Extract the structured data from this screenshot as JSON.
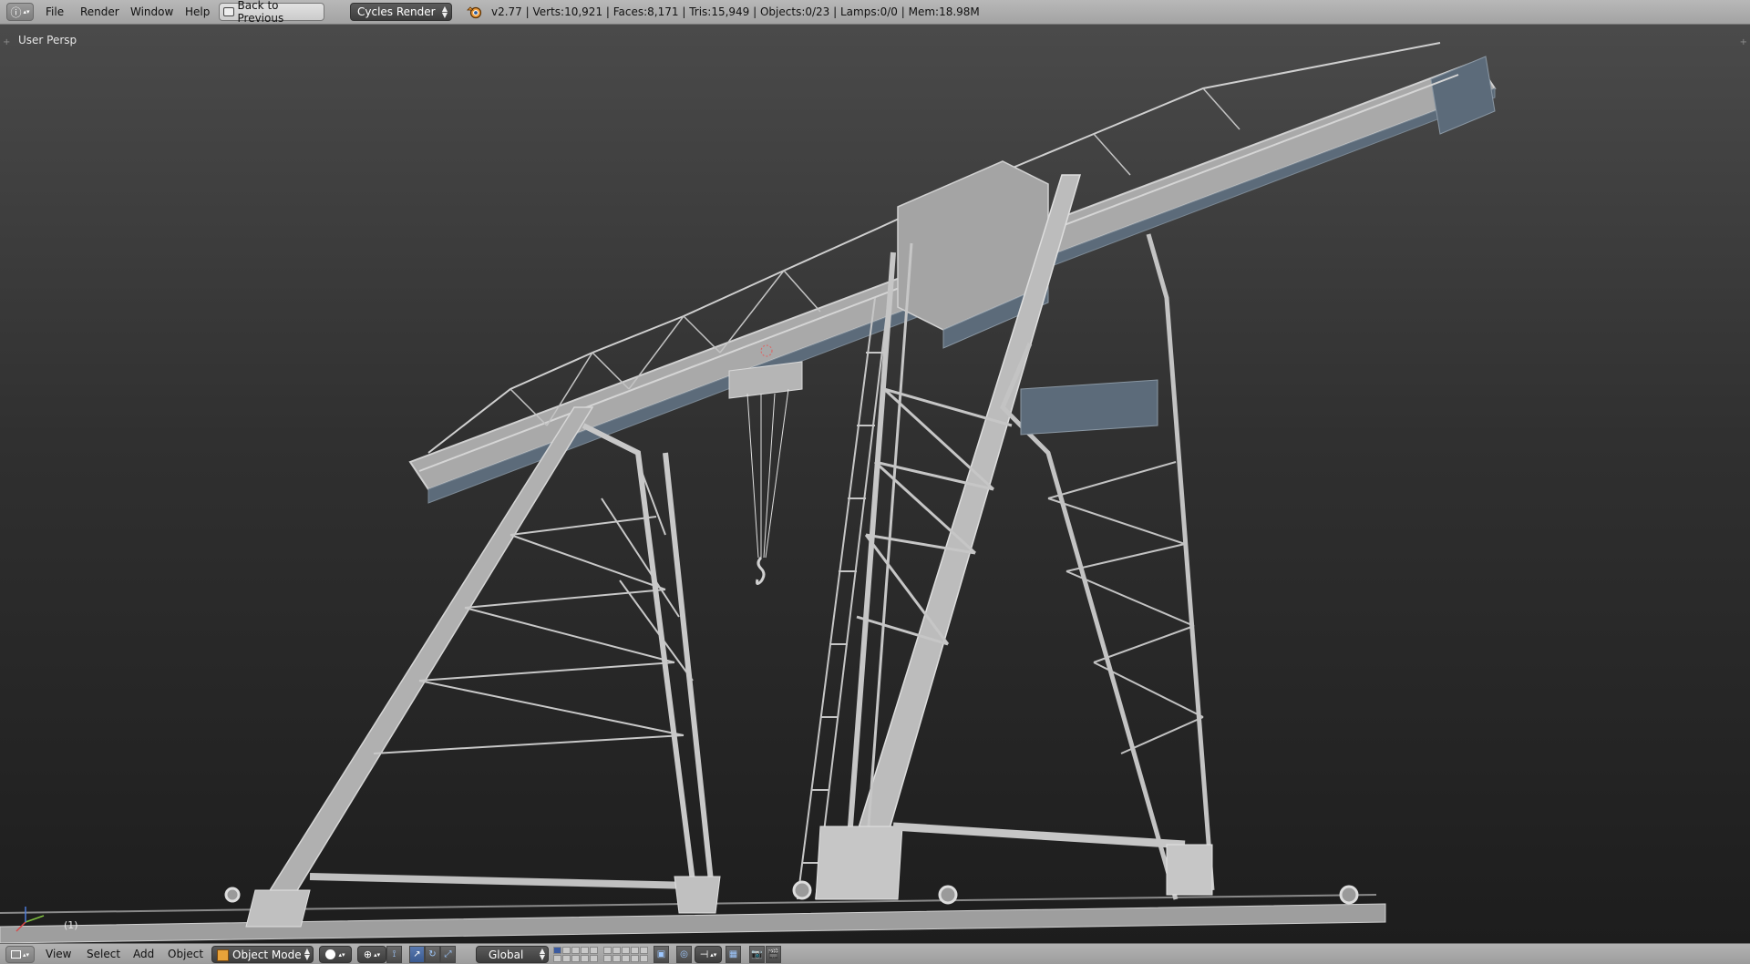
{
  "header": {
    "editor_type_icon": "info-icon",
    "menus": [
      "File",
      "Render",
      "Window",
      "Help"
    ],
    "back_button": "Back to Previous",
    "render_engine": "Cycles Render",
    "stats": "v2.77 | Verts:10,921 | Faces:8,171 | Tris:15,949 | Objects:0/23 | Lamps:0/0 | Mem:18.98M"
  },
  "viewport": {
    "view_label": "User Persp",
    "frame_label": "(1)"
  },
  "footer": {
    "editor_type_icon": "3d-view-icon",
    "menus": [
      "View",
      "Select",
      "Add",
      "Object"
    ],
    "mode": "Object Mode",
    "orientation": "Global",
    "icons": [
      "viewport-shading-icon",
      "pivot-point-icon",
      "manipulator-icon",
      "translate-icon",
      "rotate-icon",
      "scale-icon",
      "layers-icon",
      "lock-layers-icon",
      "proportional-edit-icon",
      "snap-icon",
      "render-still-icon",
      "render-anim-icon"
    ]
  },
  "colors": {
    "header_bg": "#a8a8a8",
    "viewport_top": "#4a4a4a",
    "viewport_bottom": "#1d1d1d",
    "crane_grey": "#b9b9b9",
    "steel_blue": "#5c6b7a"
  }
}
